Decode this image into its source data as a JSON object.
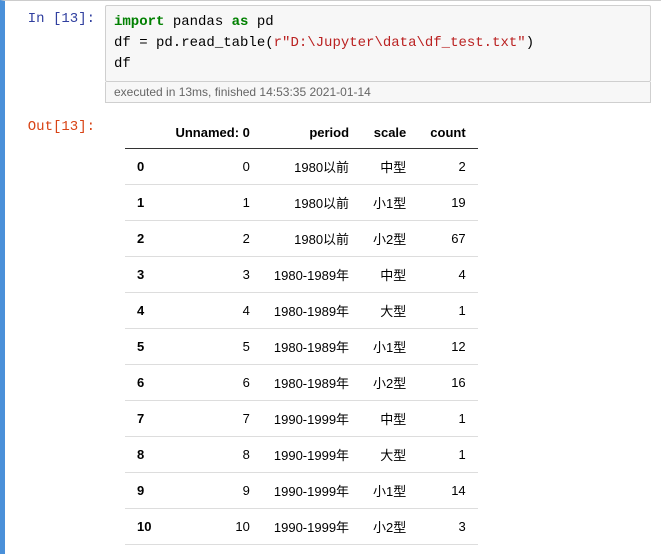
{
  "in_prompt": "In  [13]:",
  "out_prompt": "Out[13]:",
  "code": {
    "line1_kw1": "import",
    "line1_mod": " pandas ",
    "line1_kw2": "as",
    "line1_alias": " pd",
    "line2_pre": "df = pd.read_table(",
    "line2_str": "r\"D:\\Jupyter\\data\\df_test.txt\"",
    "line2_post": ")",
    "line3": "df"
  },
  "exec_info": "executed in 13ms, finished 14:53:35 2021-01-14",
  "chart_data": {
    "type": "table",
    "columns": [
      "",
      "Unnamed: 0",
      "period",
      "scale",
      "count"
    ],
    "rows": [
      [
        "0",
        "0",
        "1980以前",
        "中型",
        "2"
      ],
      [
        "1",
        "1",
        "1980以前",
        "小1型",
        "19"
      ],
      [
        "2",
        "2",
        "1980以前",
        "小2型",
        "67"
      ],
      [
        "3",
        "3",
        "1980-1989年",
        "中型",
        "4"
      ],
      [
        "4",
        "4",
        "1980-1989年",
        "大型",
        "1"
      ],
      [
        "5",
        "5",
        "1980-1989年",
        "小1型",
        "12"
      ],
      [
        "6",
        "6",
        "1980-1989年",
        "小2型",
        "16"
      ],
      [
        "7",
        "7",
        "1990-1999年",
        "中型",
        "1"
      ],
      [
        "8",
        "8",
        "1990-1999年",
        "大型",
        "1"
      ],
      [
        "9",
        "9",
        "1990-1999年",
        "小1型",
        "14"
      ],
      [
        "10",
        "10",
        "1990-1999年",
        "小2型",
        "3"
      ]
    ]
  }
}
